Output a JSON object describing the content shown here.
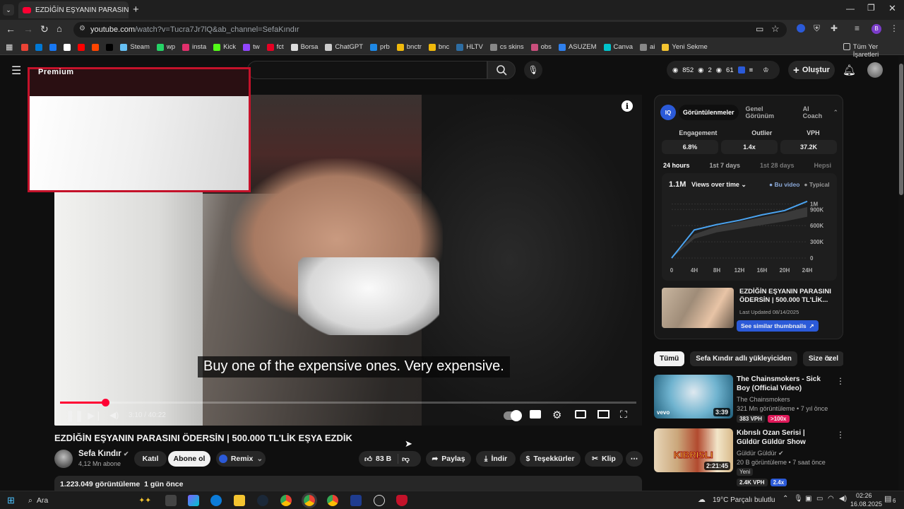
{
  "browser": {
    "tab_title": "EZDİĞİN EŞYANIN PARASINI",
    "url_host": "youtube.com",
    "url_path": "/watch?v=Tucra7Jr7lQ&ab_channel=SefaKındır",
    "bookmarks": [
      {
        "label": "",
        "color": "#ea4335"
      },
      {
        "label": "",
        "color": "#0078d4"
      },
      {
        "label": "",
        "color": "#1877f2"
      },
      {
        "label": "",
        "color": "#ffffff"
      },
      {
        "label": "",
        "color": "#ff0000"
      },
      {
        "label": "",
        "color": "#ff4500"
      },
      {
        "label": "",
        "color": "#000000"
      },
      {
        "label": "Steam",
        "color": "#66c0f4"
      },
      {
        "label": "wp",
        "color": "#25d366"
      },
      {
        "label": "insta",
        "color": "#e1306c"
      },
      {
        "label": "Kick",
        "color": "#53fc18"
      },
      {
        "label": "tw",
        "color": "#9146ff"
      },
      {
        "label": "fct",
        "color": "#e60023"
      },
      {
        "label": "Borsa",
        "color": "#dddddd"
      },
      {
        "label": "ChatGPT",
        "color": "#cccccc"
      },
      {
        "label": "prb",
        "color": "#1e88e5"
      },
      {
        "label": "bnctr",
        "color": "#f0b90b"
      },
      {
        "label": "bnc",
        "color": "#f0b90b"
      },
      {
        "label": "HLTV",
        "color": "#2d6da3"
      },
      {
        "label": "cs skins",
        "color": "#888888"
      },
      {
        "label": "obs",
        "color": "#c94f7c"
      },
      {
        "label": "ASUZEM",
        "color": "#2f80ed"
      },
      {
        "label": "Canva",
        "color": "#00c4cc"
      },
      {
        "label": "ai",
        "color": "#888888"
      },
      {
        "label": "Yeni Sekme",
        "color": "#f4c430"
      }
    ],
    "all_bookmarks": "Tüm Yer İşaretleri"
  },
  "youtube": {
    "logo_text": "Premium",
    "stats": {
      "a": "852",
      "b": "2",
      "c": "61"
    },
    "create_label": "Oluştur"
  },
  "player": {
    "caption": "Buy one of the expensive ones.  Very expensive.",
    "time": "3:10 / 40:22",
    "progress": 0.078
  },
  "video": {
    "title": "EZDİĞİN EŞYANIN PARASINI ÖDERSİN | 500.000 TL'LİK EŞYA EZDİK",
    "channel": "Sefa Kındır",
    "subs": "4,12 Mn abone",
    "join": "Katıl",
    "subscribe": "Abone ol",
    "remix": "Remix",
    "likes": "83 B",
    "share": "Paylaş",
    "download": "İndir",
    "thanks": "Teşekkürler",
    "clip": "Klip",
    "views": "1.223.049 görüntüleme",
    "age": "1 gün önce"
  },
  "vidiq": {
    "tabs": [
      "Görüntülenmeler",
      "Genel Görünüm",
      "AI Coach"
    ],
    "metrics": [
      {
        "label": "Engagement",
        "value": "6.8%"
      },
      {
        "label": "Outlier",
        "value": "1.4x"
      },
      {
        "label": "VPH",
        "value": "37.2K"
      }
    ],
    "ranges": [
      "24 hours",
      "1st 7 days",
      "1st 28 days",
      "Hepsi"
    ],
    "total": "1.1M",
    "dropdown": "Views over time",
    "legend": [
      "Bu video",
      "Typical"
    ],
    "thumb_title": "EZDİĞİN EŞYANIN PARASINI ÖDERSİN | 500.000 TL'LİK...",
    "last_updated": "Last Updated 08/14/2025",
    "similar": "See similar thumbnails",
    "chart_data": {
      "type": "line",
      "x": [
        "0",
        "4H",
        "8H",
        "12H",
        "16H",
        "20H",
        "24H"
      ],
      "y_ticks": [
        "0",
        "300K",
        "600K",
        "900K",
        "1M"
      ],
      "ylim": [
        0,
        1100000
      ],
      "series": [
        {
          "name": "Bu video",
          "values": [
            0,
            520000,
            620000,
            700000,
            800000,
            880000,
            1050000
          ]
        },
        {
          "name": "Typical",
          "values": [
            0,
            420000,
            560000,
            640000,
            720000,
            800000,
            900000
          ]
        }
      ]
    }
  },
  "filters": [
    "Tümü",
    "Sefa Kındır adlı yükleyiciden",
    "Size özel"
  ],
  "recommendations": [
    {
      "title": "The Chainsmokers - Sick Boy (Official Video)",
      "channel": "The Chainsmokers",
      "meta": "321 Mn görüntüleme • 7 yıl önce",
      "duration": "3:39",
      "vph": "383 VPH",
      "outlier": ">100x",
      "outlier_color": "#e0195a",
      "badge": ""
    },
    {
      "title": "Kıbrıslı Ozan Serisi | Güldür Güldür Show",
      "channel": "Güldür Güldür",
      "meta": "20 B görüntüleme • 7 saat önce",
      "duration": "2:21:45",
      "vph": "2.4K VPH",
      "outlier": "2.4x",
      "outlier_color": "#2b5ad8",
      "badge": "Yeni"
    }
  ],
  "taskbar": {
    "search": "Ara",
    "weather": "19°C  Parçalı bulutlu",
    "time": "02:26",
    "date": "16.08.2025",
    "notif": "6"
  }
}
